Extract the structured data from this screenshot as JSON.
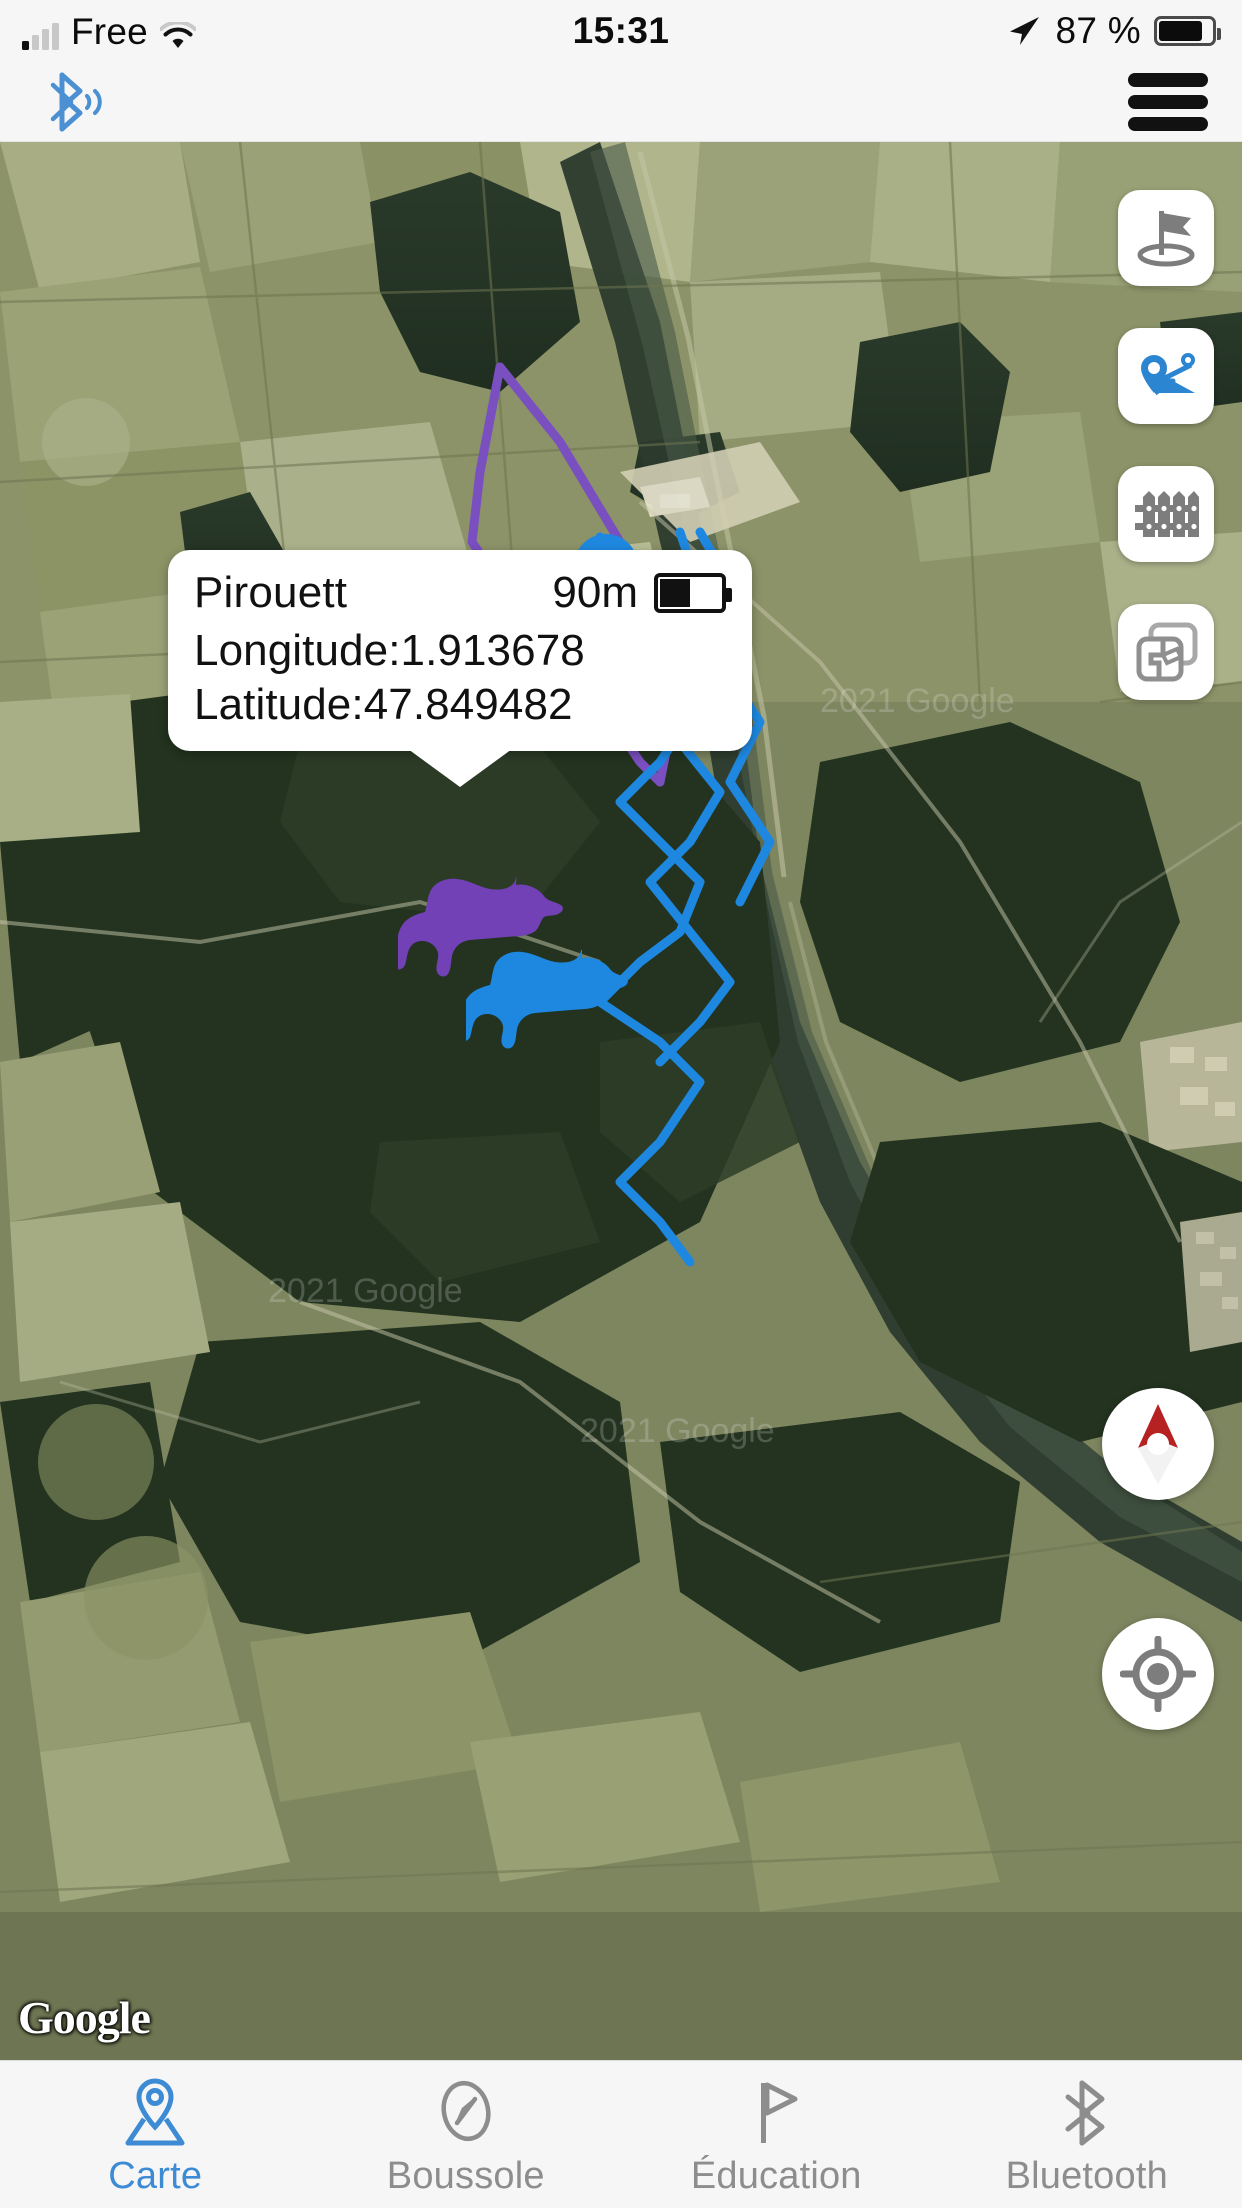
{
  "status_bar": {
    "carrier": "Free",
    "time": "15:31",
    "battery_percent": "87 %",
    "battery_level": 82,
    "signal_icon": "signal-bars-icon",
    "wifi_icon": "wifi-icon",
    "location_icon": "location-arrow-icon",
    "battery_icon": "battery-icon"
  },
  "header": {
    "bluetooth_icon": "bluetooth-connected-icon",
    "menu_icon": "hamburger-menu-icon",
    "bluetooth_color": "#3d8bd4"
  },
  "map": {
    "provider_watermark": "Google",
    "attribution": "2021 Google",
    "type": "satellite",
    "controls": [
      {
        "name": "place-flag-button",
        "icon": "flag-on-ground-icon",
        "color": "#7d7d7d",
        "active": false
      },
      {
        "name": "show-tracks-button",
        "icon": "route-pin-icon",
        "color": "#2c85d0",
        "active": true
      },
      {
        "name": "virtual-fence-button",
        "icon": "fence-icon",
        "color": "#7d7d7d",
        "active": false
      },
      {
        "name": "map-layers-button",
        "icon": "layers-icon",
        "color": "#a0a0a0",
        "active": false
      }
    ],
    "compass_button": {
      "name": "compass-button",
      "icon": "compass-needle-icon",
      "needle_color": "#b62121"
    },
    "locate_button": {
      "name": "locate-me-button",
      "icon": "crosshair-target-icon",
      "color": "#7d7d7d"
    },
    "dogs": [
      {
        "name": "Pirouett",
        "color": "#7241b5",
        "track_color": "#7a4fc0",
        "distance": "90m",
        "battery_level": 50
      },
      {
        "name": "dog-2",
        "color": "#1e88e0",
        "track_color": "#1e88e0",
        "distance": "",
        "battery_level": 0
      }
    ]
  },
  "callout": {
    "dog_name": "Pirouett",
    "distance": "90m",
    "battery_level": 50,
    "longitude_line": "Longitude:1.913678",
    "latitude_line": "Latitude:47.849482",
    "longitude_value": "1.913678",
    "latitude_value": "47.849482"
  },
  "tabbar": {
    "active_color": "#3d8bd4",
    "inactive_color": "#8d8d8d",
    "tabs": [
      {
        "label": "Carte",
        "icon": "map-pin-icon",
        "active": true
      },
      {
        "label": "Boussole",
        "icon": "compass-icon",
        "active": false
      },
      {
        "label": "Éducation",
        "icon": "flag-icon",
        "active": false
      },
      {
        "label": "Bluetooth",
        "icon": "bluetooth-icon",
        "active": false
      }
    ]
  }
}
